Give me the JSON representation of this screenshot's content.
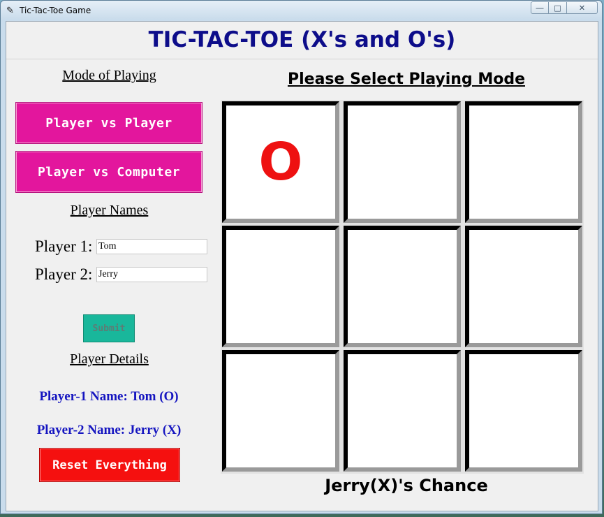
{
  "window": {
    "title": "Tic-Tac-Toe Game",
    "app_icon": "feather-icon",
    "controls": {
      "minimize": "minimize-icon",
      "maximize": "maximize-icon",
      "close": "close-icon"
    }
  },
  "header": {
    "title": "TIC-TAC-TOE (X's and O's)"
  },
  "sidebar": {
    "mode_label": "Mode of Playing",
    "pvp_button": "Player vs Player",
    "pvc_button": "Player vs Computer",
    "names_label": "Player Names",
    "player1_label": "Player 1:",
    "player1_value": "Tom",
    "player2_label": "Player 2:",
    "player2_value": "Jerry",
    "submit_button": "Submit",
    "details_label": "Player Details",
    "player1_detail": "Player-1 Name: Tom (O)",
    "player2_detail": "Player-2 Name: Jerry (X)",
    "reset_button": "Reset Everything"
  },
  "board": {
    "heading": "Please Select Playing Mode",
    "cells": [
      "O",
      "",
      "",
      "",
      "",
      "",
      "",
      "",
      ""
    ],
    "turn": "Jerry(X)'s Chance"
  },
  "colors": {
    "title": "#0d0d8a",
    "mode_buttons": "#e3169d",
    "submit_button": "#19b79b",
    "reset_button": "#f5100f",
    "details_text": "#1515c0",
    "mark": "#ee1111"
  }
}
